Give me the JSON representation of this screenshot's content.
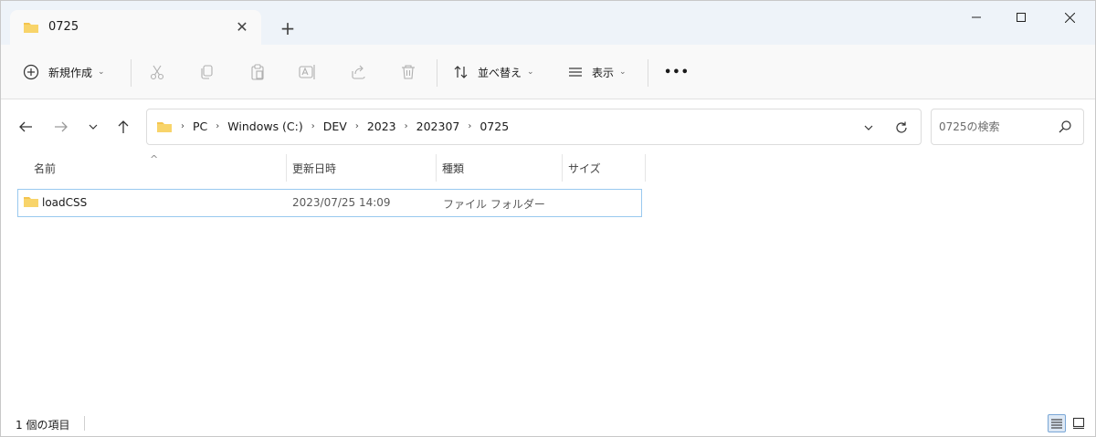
{
  "window": {
    "tab_title": "0725",
    "new_tab": "+",
    "tab_close": "✕"
  },
  "toolbar": {
    "new_label": "新規作成",
    "sort_label": "並べ替え",
    "view_label": "表示",
    "more_label": "•••"
  },
  "address": {
    "crumbs": [
      "PC",
      "Windows (C:)",
      "DEV",
      "2023",
      "202307",
      "0725"
    ]
  },
  "search": {
    "placeholder": "0725の検索"
  },
  "columns": {
    "name": "名前",
    "date": "更新日時",
    "type": "種類",
    "size": "サイズ"
  },
  "files": [
    {
      "name": "loadCSS",
      "date": "2023/07/25 14:09",
      "type": "ファイル フォルダー",
      "size": ""
    }
  ],
  "status": {
    "count": "1 個の項目"
  },
  "colors": {
    "titlebar": "#eef3f9",
    "folder": "#f4c44e",
    "selection_border": "#99c9ef"
  },
  "icons": [
    "folder-icon",
    "new-icon",
    "cut-icon",
    "copy-icon",
    "paste-icon",
    "rename-icon",
    "share-icon",
    "delete-icon",
    "sort-icon",
    "view-icon",
    "back-icon",
    "forward-icon",
    "recent-icon",
    "up-icon",
    "refresh-icon",
    "search-icon",
    "details-view-icon",
    "tiles-view-icon"
  ]
}
